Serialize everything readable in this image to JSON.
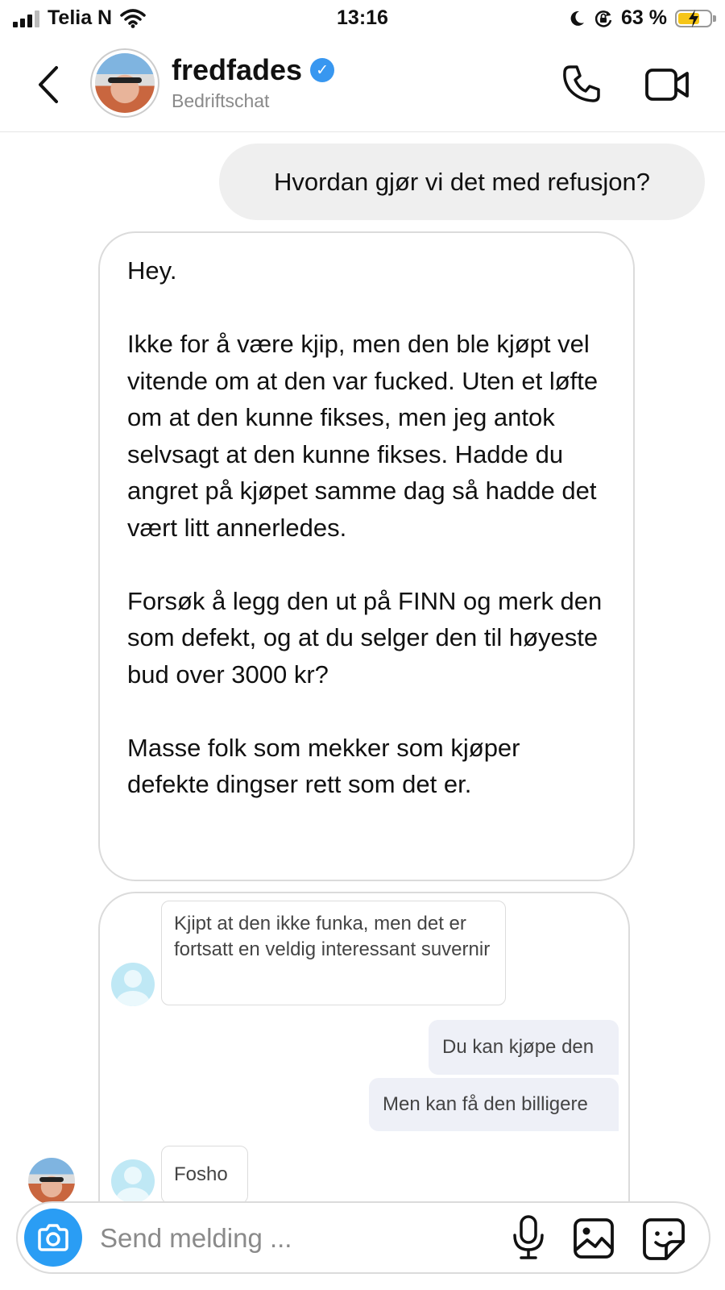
{
  "status_bar": {
    "carrier": "Telia N",
    "time": "13:16",
    "battery": "63 %",
    "battery_level": 0.63,
    "icons": [
      "signal-icon",
      "wifi-icon",
      "moon-icon",
      "orientation-lock-icon",
      "battery-charging-icon"
    ]
  },
  "header": {
    "username": "fredfades",
    "subtitle": "Bedriftschat",
    "verified": true,
    "icons": [
      "back-chevron-icon",
      "verified-badge-icon",
      "phone-icon",
      "video-camera-icon"
    ]
  },
  "messages": {
    "outgoing_1": "Hvordan gjør vi det med refusjon?",
    "incoming_1": {
      "p1": "Hey.",
      "p2": "Ikke for å være kjip, men den ble kjøpt vel vitende om at den var fucked. Uten et løfte om at den kunne fikses, men jeg antok selvsagt at den kunne fikses. Hadde du angret på kjøpet samme dag så hadde det vært litt annerledes.",
      "p3": "Forsøk å legg den ut på FINN og merk den som defekt, og at du selger den til høyeste bud over 3000 kr?",
      "p4": "Masse folk som mekker som kjøper defekte dingser rett som det er."
    }
  },
  "shared_screenshot": {
    "m1": "Kjipt at den ikke funka, men det er fortsatt en veldig interessant suvernir",
    "m2": "Du kan kjøpe den",
    "m3": "Men kan få den billigere",
    "m4": "Fosho"
  },
  "composer": {
    "placeholder": "Send melding ...",
    "accent": "#2a9df4",
    "icons": [
      "camera-icon",
      "microphone-icon",
      "image-icon",
      "sticker-icon"
    ]
  },
  "colors": {
    "outgoing_bubble": "#efefef",
    "incoming_border": "#dbdbdb",
    "verified": "#3897f0"
  }
}
